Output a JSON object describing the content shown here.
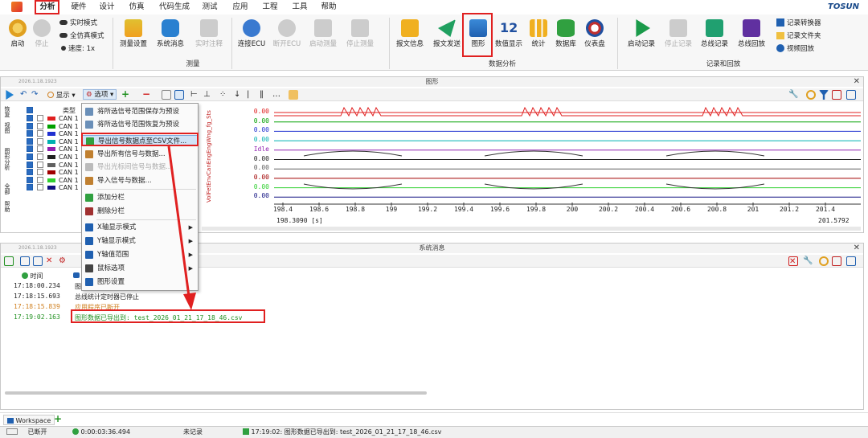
{
  "menu": {
    "items": [
      "分析",
      "硬件",
      "设计",
      "仿真",
      "代码生成",
      "测试",
      "应用",
      "工程",
      "工具",
      "帮助"
    ],
    "brand": "TOSUN"
  },
  "ribbon": {
    "start": "启动",
    "stop": "停止",
    "realtime_mode": "实时模式",
    "full_sim_mode": "全仿真模式",
    "speed": "速度: 1x",
    "meas_setup": "测量设置",
    "sys_msg": "系统消息",
    "realtime_note": "实时注释",
    "group_measure": "测量",
    "connect_ecu": "连接ECU",
    "disconnect_ecu": "断开ECU",
    "start_measure": "启动测量",
    "stop_measure": "停止测量",
    "msg_info": "报文信息",
    "msg_send": "报文发送",
    "graph": "图形",
    "num_display": "数值显示",
    "stats": "统计",
    "database": "数据库",
    "dashboard": "仪表盘",
    "group_analysis": "数据分析",
    "num_icon": "12",
    "start_record": "启动记录",
    "stop_record": "停止记录",
    "bus_record": "总线记录",
    "bus_replay": "总线回放",
    "record_converter": "记录转换器",
    "record_folder": "记录文件夹",
    "video_replay": "视频回放",
    "group_record": "记录和回放"
  },
  "graph_panel": {
    "date": "2026.1.18.1923",
    "title": "图形",
    "toolbar_display": "显示",
    "toolbar_options": "选项",
    "col_type": "类型",
    "side_labels": [
      "恢复",
      "视图",
      "图形分析",
      "全部",
      "帮助"
    ],
    "signals": [
      "CAN 1",
      "CAN 1",
      "CAN 1",
      "CAN 1",
      "CAN 1",
      "CAN 1",
      "CAN 1",
      "CAN 1",
      "CAN 1",
      "CAN 1"
    ],
    "rotated_names": "VolFetEnvCanEngEngWng_fg_Sts",
    "values": [
      "0.00",
      "0.00",
      "0.00",
      "0.00",
      "Idle",
      "0.00",
      "0.00",
      "0.00",
      "0.00",
      "0.00"
    ],
    "x_ticks": [
      "198.4",
      "198.6",
      "198.8",
      "199",
      "199.2",
      "199.4",
      "199.6",
      "199.8",
      "200",
      "200.2",
      "200.4",
      "200.6",
      "200.8",
      "201",
      "201.2",
      "201.4"
    ],
    "x_start": "198.3090 [s]",
    "x_end": "201.5792"
  },
  "dropdown": {
    "items": [
      {
        "label": "将所选信号范围保存为预设",
        "icon": "save-preset-icon"
      },
      {
        "label": "将所选信号范围恢复为预设",
        "icon": "restore-preset-icon"
      },
      {
        "label": "导出信号数据点至CSV文件...",
        "icon": "export-csv-icon"
      },
      {
        "label": "导出所有信号与数据...",
        "icon": "export-all-icon"
      },
      {
        "label": "导出光标间信号与数据...",
        "icon": "export-cursor-icon"
      },
      {
        "label": "导入信号与数据...",
        "icon": "import-icon"
      },
      {
        "label": "添加分栏",
        "icon": "add-split-icon"
      },
      {
        "label": "删除分栏",
        "icon": "delete-split-icon"
      },
      {
        "label": "X轴显示模式",
        "icon": "x-axis-icon"
      },
      {
        "label": "Y轴显示模式",
        "icon": "y-axis-icon"
      },
      {
        "label": "Y轴值范围",
        "icon": "y-range-icon"
      },
      {
        "label": "鼠标选项",
        "icon": "mouse-icon"
      },
      {
        "label": "图形设置",
        "icon": "settings-icon"
      }
    ]
  },
  "sysmsg_panel": {
    "date": "2026.1.18.1923",
    "title": "系统消息",
    "col_time": "时间",
    "rows": [
      {
        "time": "17:18:00.234",
        "msg": "图"
      },
      {
        "time": "17:18:15.693",
        "msg": "总线统计定时器已停止"
      },
      {
        "time": "17:18:15.839",
        "msg": "应用程序已断开"
      },
      {
        "time": "17:19:02.163",
        "msg": "图形数据已导出到: test_2026_01_21_17_18_46.csv"
      }
    ]
  },
  "workspace_tab": "Workspace",
  "statusbar": {
    "connection": "已断开",
    "time": "0:00:03:36.494",
    "record": "未记录",
    "last_msg": "17:19:02: 图形数据已导出到: test_2026_01_21_17_18_46.csv"
  },
  "colors": {
    "red_highlight": "#e02020",
    "signal_colors": [
      "#e02020",
      "#00a000",
      "#2030d0",
      "#00b0b0",
      "#9020b0",
      "#202020",
      "#606060",
      "#a00000",
      "#30d030",
      "#101080"
    ]
  }
}
